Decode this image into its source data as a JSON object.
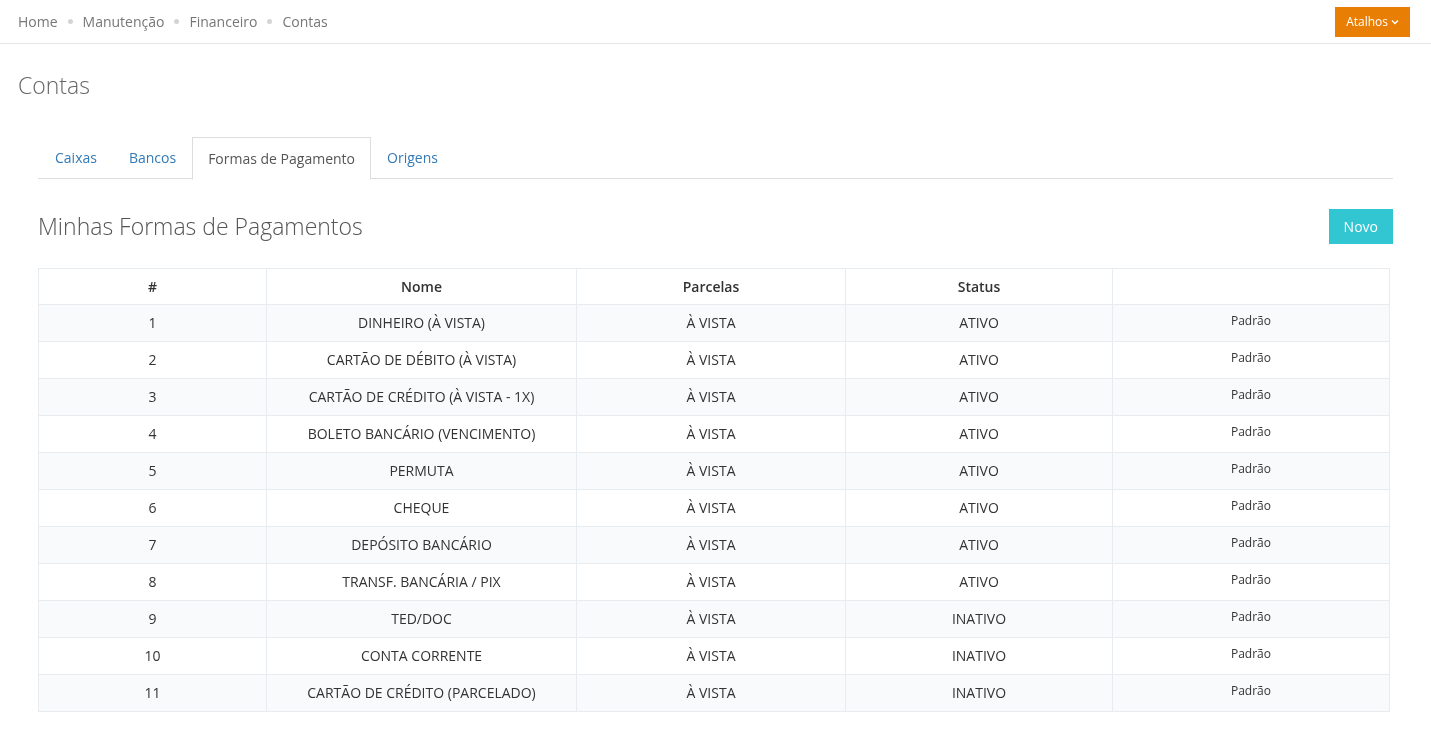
{
  "breadcrumb": [
    "Home",
    "Manutenção",
    "Financeiro",
    "Contas"
  ],
  "shortcuts_button": {
    "label": "Atalhos"
  },
  "page_title": "Contas",
  "tabs": [
    {
      "label": "Caixas",
      "selected": false
    },
    {
      "label": "Bancos",
      "selected": false
    },
    {
      "label": "Formas de Pagamento",
      "selected": true
    },
    {
      "label": "Origens",
      "selected": false
    }
  ],
  "section_title": "Minhas Formas de Pagamentos",
  "new_button": {
    "label": "Novo"
  },
  "table": {
    "columns": [
      "#",
      "Nome",
      "Parcelas",
      "Status"
    ],
    "rows": [
      {
        "number": "1",
        "name": "DINHEIRO (À VISTA)",
        "installments": "À VISTA",
        "status": "ATIVO",
        "action": "Padrão"
      },
      {
        "number": "2",
        "name": "CARTÃO DE DÉBITO (À VISTA)",
        "installments": "À VISTA",
        "status": "ATIVO",
        "action": "Padrão"
      },
      {
        "number": "3",
        "name": "CARTÃO DE CRÉDITO (À VISTA - 1X)",
        "installments": "À VISTA",
        "status": "ATIVO",
        "action": "Padrão"
      },
      {
        "number": "4",
        "name": "BOLETO BANCÁRIO (VENCIMENTO)",
        "installments": "À VISTA",
        "status": "ATIVO",
        "action": "Padrão"
      },
      {
        "number": "5",
        "name": "PERMUTA",
        "installments": "À VISTA",
        "status": "ATIVO",
        "action": "Padrão"
      },
      {
        "number": "6",
        "name": "CHEQUE",
        "installments": "À VISTA",
        "status": "ATIVO",
        "action": "Padrão"
      },
      {
        "number": "7",
        "name": "DEPÓSITO BANCÁRIO",
        "installments": "À VISTA",
        "status": "ATIVO",
        "action": "Padrão"
      },
      {
        "number": "8",
        "name": "TRANSF. BANCÁRIA / PIX",
        "installments": "À VISTA",
        "status": "ATIVO",
        "action": "Padrão"
      },
      {
        "number": "9",
        "name": "TED/DOC",
        "installments": "À VISTA",
        "status": "INATIVO",
        "action": "Padrão"
      },
      {
        "number": "10",
        "name": "CONTA CORRENTE",
        "installments": "À VISTA",
        "status": "INATIVO",
        "action": "Padrão"
      },
      {
        "number": "11",
        "name": "CARTÃO DE CRÉDITO (PARCELADO)",
        "installments": "À VISTA",
        "status": "INATIVO",
        "action": "Padrão"
      }
    ]
  }
}
